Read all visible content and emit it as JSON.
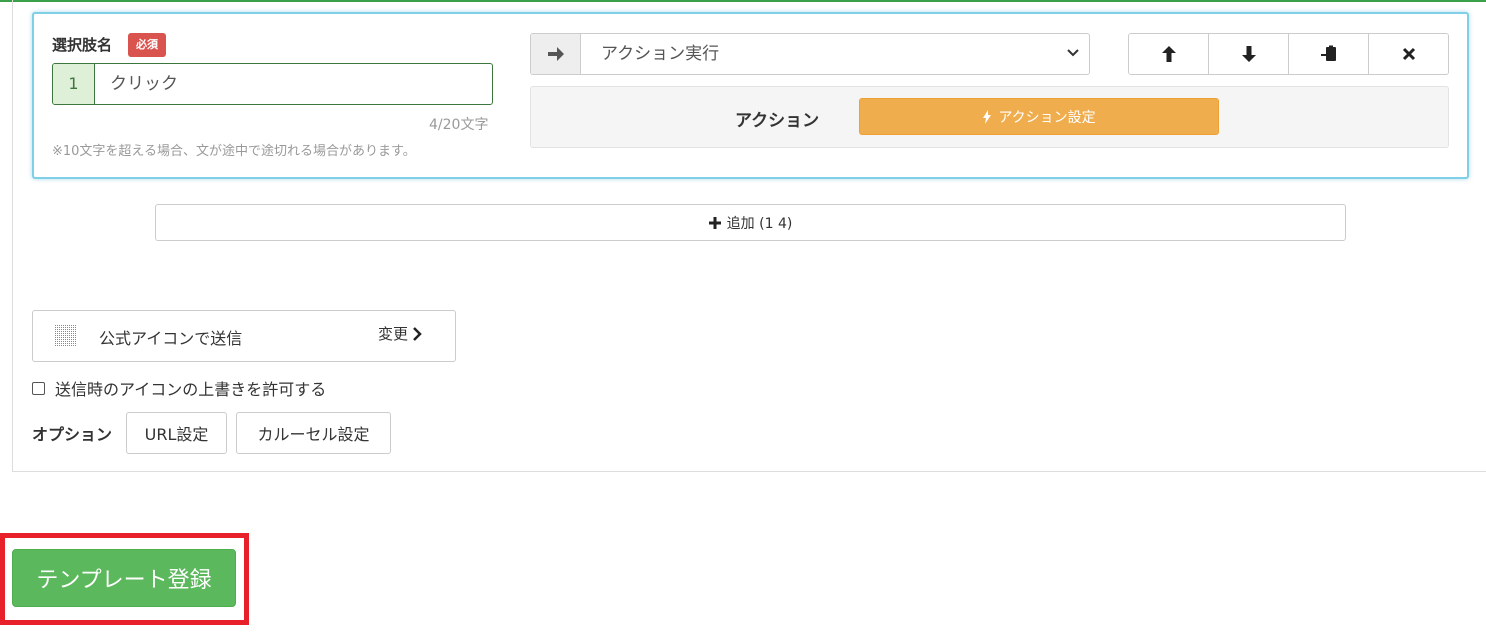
{
  "choice": {
    "label": "選択肢名",
    "required_badge": "必須",
    "index": "1",
    "value": "クリック",
    "char_count": "4/20文字",
    "note": "※10文字を超える場合、文が途中で途切れる場合があります。"
  },
  "action_type": {
    "arrow_icon": "arrow-right-icon",
    "selected": "アクション実行"
  },
  "row_buttons": [
    "arrow-up-icon",
    "arrow-down-icon",
    "paste-icon",
    "close-icon"
  ],
  "action": {
    "label": "アクション",
    "button_label": "アクション設定",
    "button_icon": "bolt-icon"
  },
  "add_button": {
    "label": "追加 (1 4)"
  },
  "icon_setting": {
    "label": "公式アイコンで送信",
    "change_label": "変更"
  },
  "override_checkbox": {
    "label": "送信時のアイコンの上書きを許可する",
    "checked": false
  },
  "options": {
    "label": "オプション",
    "url_button": "URL設定",
    "carousel_button": "カルーセル設定"
  },
  "register_button": {
    "label": "テンプレート登録"
  },
  "colors": {
    "top_line": "#3aa14a",
    "card_border": "#7fd0e6",
    "required_badge": "#d9534f",
    "action_button": "#f0ad4e",
    "register_button": "#5cb85c",
    "highlight": "#e8202a"
  }
}
